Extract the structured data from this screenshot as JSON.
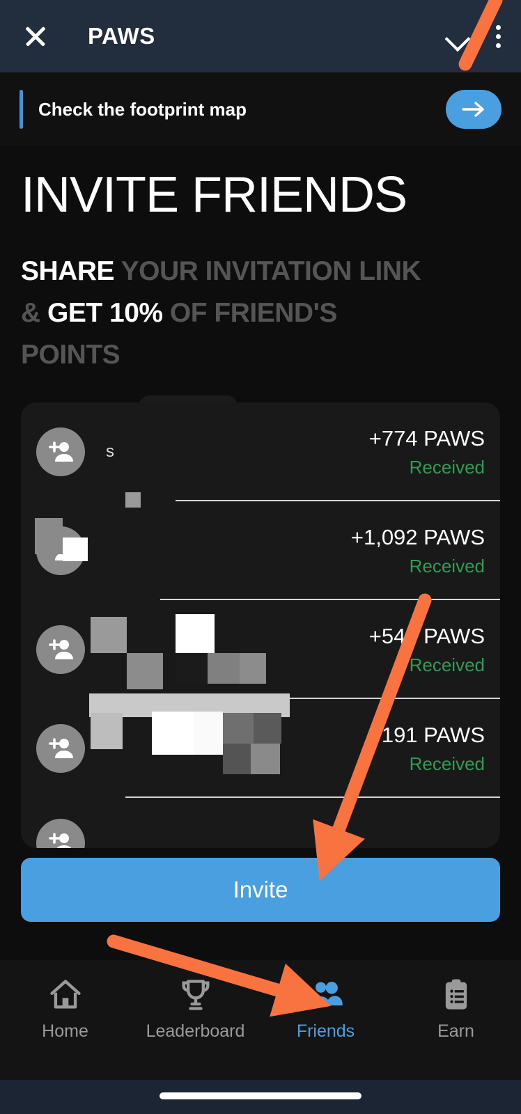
{
  "appbar": {
    "close_icon": "close-icon",
    "title": "PAWS",
    "chevron_icon": "chevron-down-icon",
    "kebab_icon": "more-vertical-icon"
  },
  "banner": {
    "text": "Check the footprint map",
    "arrow_icon": "arrow-right-icon",
    "accent_color": "#4e8fd4",
    "button_color": "#4a9fe0"
  },
  "hero": {
    "title": "INVITE FRIENDS",
    "subtitle_parts": [
      {
        "text": "SHARE ",
        "highlight": true
      },
      {
        "text": "YOUR INVITATION LINK & ",
        "highlight": false
      },
      {
        "text": "GET 10% ",
        "highlight": true
      },
      {
        "text": "OF FRIEND'S POINTS",
        "highlight": false
      }
    ]
  },
  "referrals": {
    "rows": [
      {
        "name": "s",
        "amount": "+774 PAWS",
        "status": "Received",
        "avatar_icon": "person-add-icon"
      },
      {
        "name": "",
        "amount": "+1,092 PAWS",
        "status": "Received",
        "avatar_icon": "person-add-icon"
      },
      {
        "name": "",
        "amount": "+545 PAWS",
        "status": "Received",
        "avatar_icon": "person-add-icon"
      },
      {
        "name": "",
        "amount": "+191 PAWS",
        "status": "Received",
        "avatar_icon": "person-add-icon"
      }
    ],
    "status_color": "#2e9e52"
  },
  "invite": {
    "label": "Invite"
  },
  "nav": {
    "items": [
      {
        "label": "Home",
        "icon": "home-icon",
        "active": false
      },
      {
        "label": "Leaderboard",
        "icon": "trophy-icon",
        "active": false
      },
      {
        "label": "Friends",
        "icon": "people-icon",
        "active": true
      },
      {
        "label": "Earn",
        "icon": "clipboard-icon",
        "active": false
      }
    ],
    "active_color": "#4a9fe0",
    "inactive_color": "#9a9a9a"
  },
  "annotations": {
    "arrow_color": "#f97341",
    "arrow_to_invite": "invite-button",
    "arrow_to_friends_tab": "nav-friends"
  }
}
